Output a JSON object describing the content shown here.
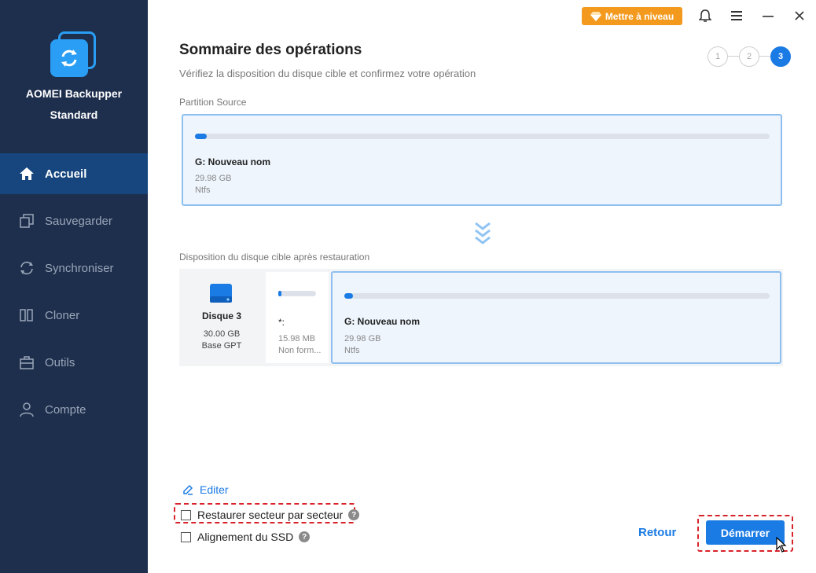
{
  "app": {
    "name": "AOMEI Backupper",
    "edition": "Standard"
  },
  "sidebar": {
    "items": [
      {
        "label": "Accueil",
        "icon": "home-icon",
        "active": true
      },
      {
        "label": "Sauvegarder",
        "icon": "backup-icon",
        "active": false
      },
      {
        "label": "Synchroniser",
        "icon": "sync-icon",
        "active": false
      },
      {
        "label": "Cloner",
        "icon": "clone-icon",
        "active": false
      },
      {
        "label": "Outils",
        "icon": "toolbox-icon",
        "active": false
      },
      {
        "label": "Compte",
        "icon": "user-icon",
        "active": false
      }
    ]
  },
  "topbar": {
    "upgrade_label": "Mettre à niveau"
  },
  "header": {
    "title": "Sommaire des opérations",
    "subtitle": "Vérifiez la disposition du disque cible et confirmez votre opération",
    "steps": [
      "1",
      "2",
      "3"
    ],
    "current_step": 3
  },
  "source": {
    "label": "Partition Source",
    "partition": {
      "name": "G: Nouveau nom",
      "size": "29.98 GB",
      "fs": "Ntfs",
      "used_fraction": 0.02
    }
  },
  "target": {
    "label": "Disposition du disque cible après restauration",
    "disk": {
      "name": "Disque 3",
      "size": "30.00 GB",
      "type": "Base GPT"
    },
    "unallocated": {
      "name": "*:",
      "size": "15.98 MB",
      "fs": "Non form..."
    },
    "partition": {
      "name": "G: Nouveau nom",
      "size": "29.98 GB",
      "fs": "Ntfs",
      "used_fraction": 0.02
    }
  },
  "options": {
    "edit_label": "Editer",
    "sector_by_sector": {
      "label": "Restaurer secteur par secteur",
      "checked": false
    },
    "ssd_alignment": {
      "label": "Alignement du SSD",
      "checked": false
    }
  },
  "actions": {
    "back_label": "Retour",
    "start_label": "Démarrer"
  },
  "colors": {
    "sidebar": "#1e2f4d",
    "active_nav": "#16467d",
    "accent": "#1b7be4",
    "upgrade": "#f39a1e",
    "highlight": "#d9232a"
  }
}
